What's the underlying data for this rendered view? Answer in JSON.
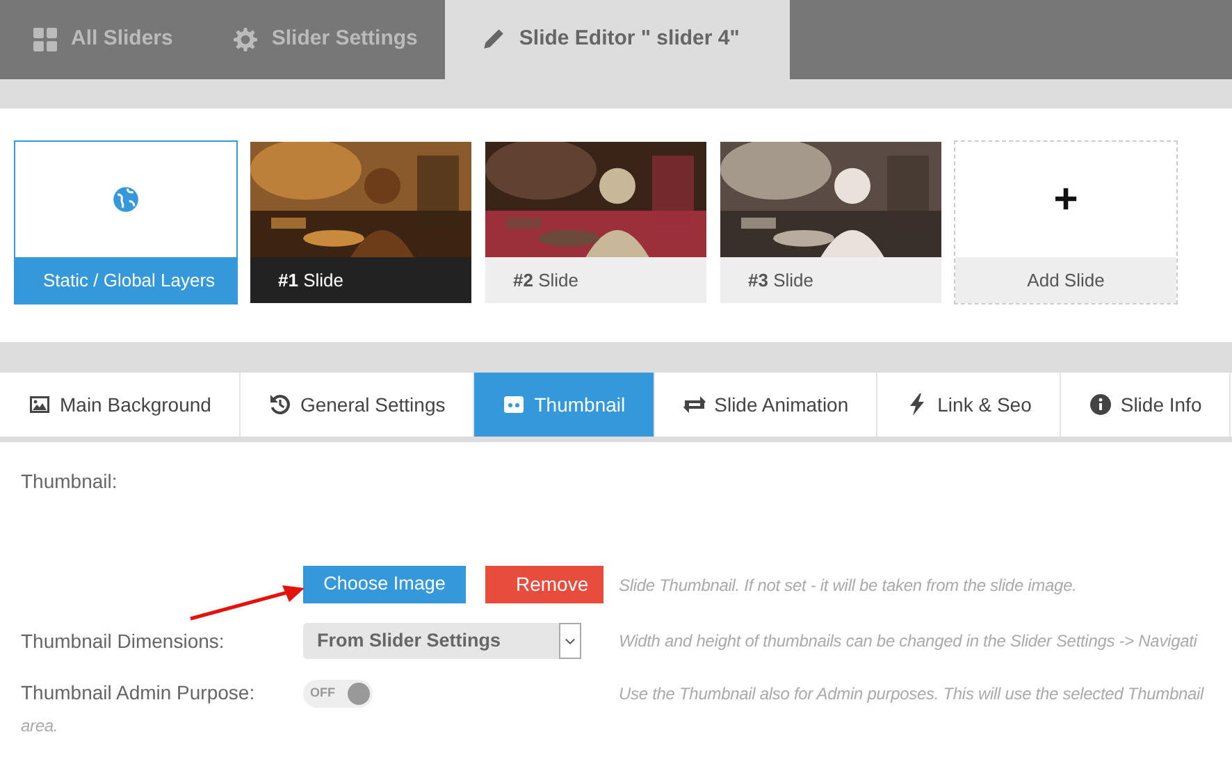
{
  "top_tabs": [
    {
      "label": "All Sliders",
      "selected": false
    },
    {
      "label": "Slider Settings",
      "selected": false
    },
    {
      "label": "Slide Editor \" slider 4\"",
      "selected": true
    }
  ],
  "slides": [
    {
      "kind": "static",
      "label": "Static / Global Layers",
      "selected": false
    },
    {
      "kind": "slide",
      "label": "**#1** Slide",
      "selected": true
    },
    {
      "kind": "slide",
      "label": "**#2** Slide",
      "selected": false
    },
    {
      "kind": "slide",
      "label": "**#3** Slide",
      "selected": false
    },
    {
      "kind": "add",
      "label": "Add Slide",
      "icon": "+",
      "selected": false
    }
  ],
  "settings_tabs": [
    {
      "label": "Main Background",
      "selected": false
    },
    {
      "label": "General Settings",
      "selected": false
    },
    {
      "label": "Thumbnail",
      "selected": true
    },
    {
      "label": "Slide Animation",
      "selected": false
    },
    {
      "label": "Link & Seo",
      "selected": false
    },
    {
      "label": "Slide Info",
      "selected": false
    }
  ],
  "form": {
    "section_label": "Thumbnail:",
    "rows": [
      {
        "kind": "buttons",
        "buttons": [
          "Choose Image",
          "Remove"
        ],
        "help": "Slide Thumbnail. If not set - it will be taken from the slide image."
      },
      {
        "kind": "select",
        "label": "Thumbnail Dimensions:",
        "value": "From Slider Settings",
        "help": "Width and height of thumbnails can be changed in the Slider Settings -> Navigati"
      },
      {
        "kind": "toggle",
        "label": "Thumbnail Admin Purpose:",
        "toggle_text": "OFF",
        "on": false,
        "help": "Use the Thumbnail also for Admin purposes. This will use the selected Thumbnail"
      }
    ],
    "help_overflow": "area."
  }
}
